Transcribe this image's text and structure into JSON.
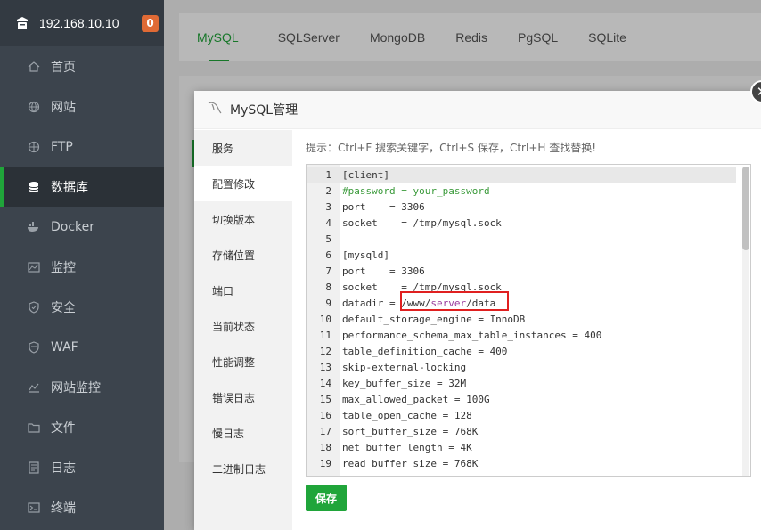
{
  "sidebar": {
    "server_ip": "192.168.10.10",
    "badge": "0",
    "items": [
      {
        "label": "首页",
        "icon": "home-icon"
      },
      {
        "label": "网站",
        "icon": "globe-icon"
      },
      {
        "label": "FTP",
        "icon": "ftp-icon"
      },
      {
        "label": "数据库",
        "icon": "database-icon",
        "active": true
      },
      {
        "label": "Docker",
        "icon": "docker-icon"
      },
      {
        "label": "监控",
        "icon": "monitor-icon"
      },
      {
        "label": "安全",
        "icon": "shield-icon"
      },
      {
        "label": "WAF",
        "icon": "waf-icon"
      },
      {
        "label": "网站监控",
        "icon": "site-monitor-icon"
      },
      {
        "label": "文件",
        "icon": "folder-icon"
      },
      {
        "label": "日志",
        "icon": "log-icon"
      },
      {
        "label": "终端",
        "icon": "terminal-icon"
      }
    ]
  },
  "tabs": [
    "MySQL",
    "SQLServer",
    "MongoDB",
    "Redis",
    "PgSQL",
    "SQLite"
  ],
  "dialog": {
    "title": "MySQL管理",
    "menu": [
      "服务",
      "配置修改",
      "切换版本",
      "存储位置",
      "端口",
      "当前状态",
      "性能调整",
      "错误日志",
      "慢日志",
      "二进制日志"
    ],
    "tip": "提示：Ctrl+F 搜索关键字，Ctrl+S 保存，Ctrl+H 查找替换!",
    "save_label": "保存"
  },
  "editor": {
    "lines": [
      "[client]",
      "#password = your_password",
      "port    = 3306",
      "socket    = /tmp/mysql.sock",
      "",
      "[mysqld]",
      "port    = 3306",
      "socket    = /tmp/mysql.sock",
      "datadir = /www/server/data",
      "default_storage_engine = InnoDB",
      "performance_schema_max_table_instances = 400",
      "table_definition_cache = 400",
      "skip-external-locking",
      "key_buffer_size = 32M",
      "max_allowed_packet = 100G",
      "table_open_cache = 128",
      "sort_buffer_size = 768K",
      "net_buffer_length = 4K",
      "read_buffer_size = 768K"
    ],
    "datadir_prefix": "datadir = ",
    "datadir_parts": [
      "/www/",
      "server",
      "/data"
    ]
  },
  "colors": {
    "accent": "#20a53a",
    "sidebar_bg": "#3c444d",
    "highlight_box": "#e02020",
    "badge": "#e06a35"
  }
}
